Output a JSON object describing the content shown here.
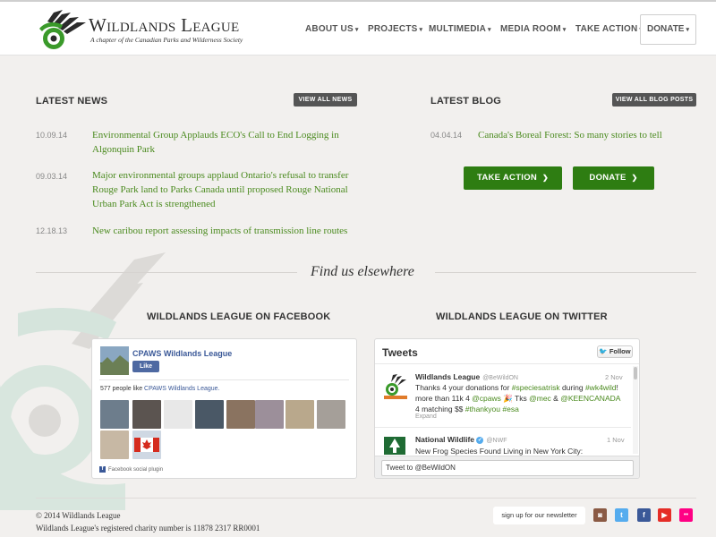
{
  "brand": {
    "title": "Wildlands League",
    "subtitle": "A chapter of the Canadian Parks and Wilderness Society",
    "colors": {
      "green": "#2e7d12",
      "link_green": "#4a8a1e",
      "logo_green": "#3a9a2a",
      "logo_dark": "#2b2b2b"
    }
  },
  "nav": {
    "items": [
      {
        "label": "ABOUT US"
      },
      {
        "label": "PROJECTS"
      },
      {
        "label": "MULTIMEDIA"
      },
      {
        "label": "MEDIA ROOM"
      },
      {
        "label": "TAKE ACTION"
      }
    ],
    "donate": "DONATE",
    "caret": "▾"
  },
  "news": {
    "title": "LATEST NEWS",
    "view_all": "VIEW ALL NEWS",
    "items": [
      {
        "date": "10.09.14",
        "title": "Environmental Group Applauds ECO's Call to End Logging in Algonquin Park"
      },
      {
        "date": "09.03.14",
        "title": "Major environmental groups applaud Ontario's refusal to transfer Rouge Park land to Parks Canada until proposed Rouge National Urban Park Act is strengthened"
      },
      {
        "date": "12.18.13",
        "title": "New caribou report assessing impacts of transmission line routes"
      }
    ]
  },
  "blog": {
    "title": "LATEST BLOG",
    "view_all": "VIEW ALL BLOG POSTS",
    "items": [
      {
        "date": "04.04.14",
        "title": "Canada's Boreal Forest: So many stories to tell"
      }
    ],
    "take_action": "TAKE ACTION",
    "donate": "DONATE",
    "arrow": "❯"
  },
  "find": {
    "title": "Find us elsewhere"
  },
  "facebook": {
    "title": "WILDLANDS LEAGUE ON FACEBOOK",
    "page_name": "CPAWS Wildlands League",
    "like": "Like",
    "count_prefix": "577 people like",
    "count_link": "CPAWS Wildlands League.",
    "plugin": "Facebook social plugin",
    "f_glyph": "f"
  },
  "twitter": {
    "title": "WILDLANDS LEAGUE ON TWITTER",
    "header": "Tweets",
    "follow": "Follow",
    "bird": "🐦",
    "tweets": [
      {
        "author": "Wildlands League",
        "handle": "@BeWildON",
        "date": "2 Nov",
        "text_parts": [
          "Thanks 4 your donations for ",
          "#speciesatrisk",
          " during ",
          "#wk4wild",
          "! more than 11k 4 ",
          "@cpaws",
          " 🎉 Tks ",
          "@mec",
          " & ",
          "@KEENCANADA",
          " 4 matching $$ ",
          "#thankyou",
          " ",
          "#esa"
        ],
        "expand": "Expand"
      },
      {
        "author": "National Wildlife",
        "handle": "@NWF",
        "date": "1 Nov",
        "text": "New Frog Species Found Living in New York City:"
      }
    ],
    "input_placeholder": "Tweet to @BeWildON"
  },
  "footer": {
    "copyright": "© 2014 Wildlands League",
    "charity": "Wildlands League's registered charity number is 11878 2317 RR0001",
    "newsletter": "sign up for our newsletter",
    "social": [
      {
        "icon": "instagram-icon",
        "glyph": "◙",
        "color": "#8a5a44"
      },
      {
        "icon": "twitter-icon",
        "glyph": "t",
        "color": "#55acee"
      },
      {
        "icon": "facebook-icon",
        "glyph": "f",
        "color": "#3b5998"
      },
      {
        "icon": "youtube-icon",
        "glyph": "▶",
        "color": "#e52d27"
      },
      {
        "icon": "flickr-icon",
        "glyph": "••",
        "color": "#ff0084"
      }
    ]
  }
}
